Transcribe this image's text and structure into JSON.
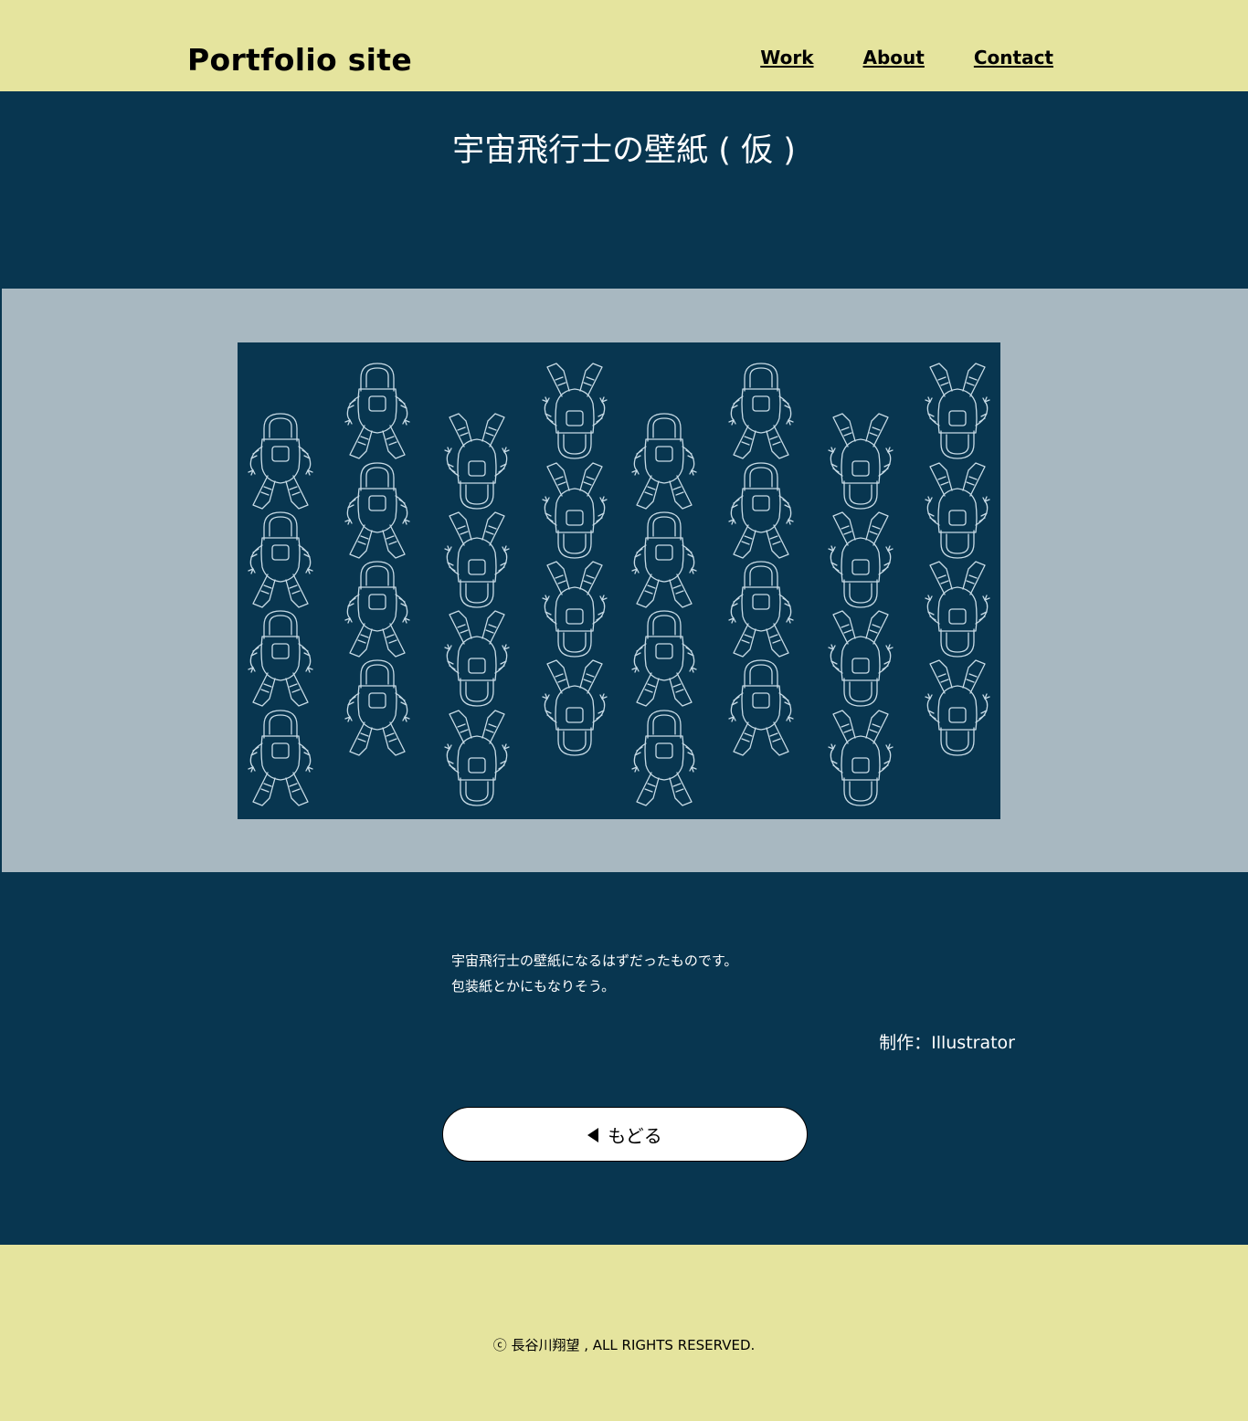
{
  "header": {
    "site_title": "Portfolio site",
    "nav": [
      {
        "label": "Work"
      },
      {
        "label": "About"
      },
      {
        "label": "Contact"
      }
    ]
  },
  "work": {
    "title": "宇宙飛行士の壁紙 ( 仮 )",
    "artwork_subject": "astronaut-pattern",
    "description_lines": [
      "宇宙飛行士の壁紙になるはずだったものです。",
      "包装紙とかにもなりそう。"
    ],
    "tools": "制作：Illustrator",
    "back_label": "もどる"
  },
  "footer": {
    "copyright": "ⓒ 長谷川翔望 , ALL RIGHTS RESERVED."
  },
  "colors": {
    "header_bg": "#e5e49e",
    "main_bg": "#083650",
    "gallery_bg": "#a8b8c1",
    "artwork_line": "#c7dbe6"
  }
}
